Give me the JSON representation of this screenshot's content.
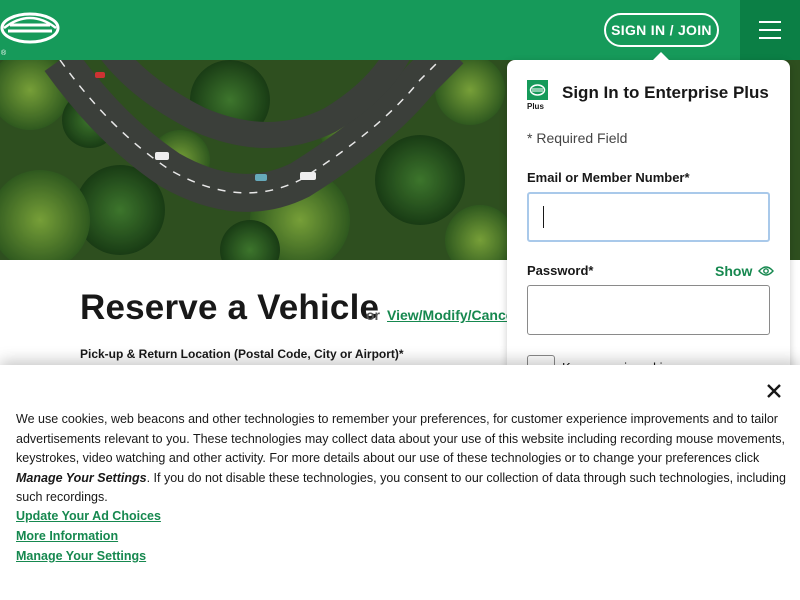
{
  "header": {
    "logo_icon": "enterprise-e-logo",
    "registered_mark": "®",
    "signin_label": "SIGN IN / JOIN",
    "menu_icon": "hamburger-menu-icon",
    "brand_green": "#169a5a",
    "menu_green": "#0b7f45"
  },
  "hero": {
    "image": "aerial-forest-road"
  },
  "reserve": {
    "title": "Reserve a Vehicle",
    "or_text": "or",
    "modify_link": "View/Modify/Cancel",
    "pickup_label": "Pick-up & Return Location (Postal Code, City or Airport)*"
  },
  "signin_panel": {
    "logo_label": "Plus",
    "title": "Sign In to Enterprise Plus",
    "required_note": "* Required Field",
    "email_label": "Email or Member Number*",
    "email_value": "",
    "password_label": "Password*",
    "show_label": "Show",
    "show_icon": "eye-icon",
    "password_value": "",
    "remember_label": "Keep me signed in",
    "link_green": "#16884f"
  },
  "cookie_banner": {
    "close_icon": "close-icon",
    "text_part1": "We use cookies, web beacons and other technologies to remember your preferences, for customer experience improvements and to tailor advertisements relevant to you. These technologies may collect data about your use of this website including recording mouse movements, keystrokes, video watching and other activity. For more details about our use of these technologies or to change your preferences click ",
    "text_emph": "Manage Your Settings",
    "text_part2": ". If you do not disable these technologies, you consent to our collection of data through such technologies, including such recordings.",
    "links": [
      "Update Your Ad Choices",
      "More Information",
      "Manage Your Settings"
    ]
  }
}
